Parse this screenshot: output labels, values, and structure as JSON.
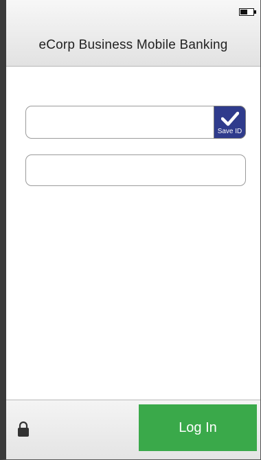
{
  "app": {
    "title": "eCorp Business Mobile Banking"
  },
  "status_bar": {
    "battery_icon": "battery-icon",
    "battery_level": 0.6
  },
  "login_form": {
    "username": {
      "value": "",
      "placeholder": ""
    },
    "save_id": {
      "label": "Save ID",
      "checked": true,
      "icon": "checkmark-icon",
      "color": "#2f3b8c"
    },
    "password": {
      "value": "",
      "placeholder": ""
    }
  },
  "footer": {
    "lock_icon": "lock-icon",
    "login_label": "Log In",
    "login_color": "#3aa94a"
  }
}
